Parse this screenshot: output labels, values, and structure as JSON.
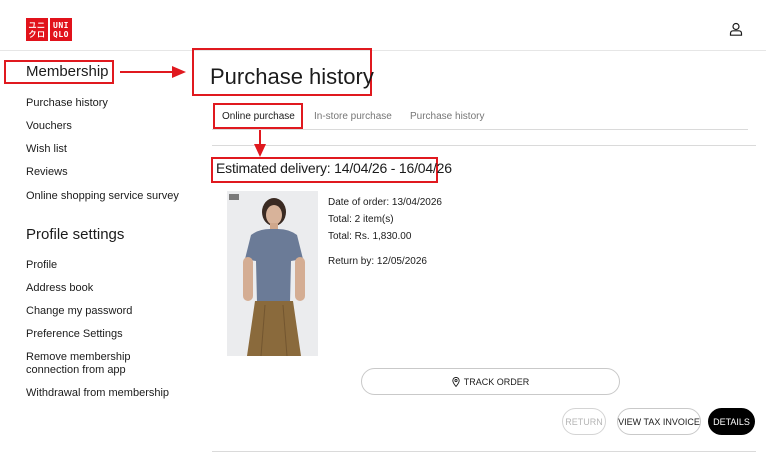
{
  "brand": {
    "logo_left": "ユニ\nクロ",
    "logo_right": "UNI\nQLO",
    "color": "#e1121b"
  },
  "header": {
    "account_icon": "user-icon"
  },
  "sidebar": {
    "membership_heading": "Membership",
    "membership_links": [
      "Purchase history",
      "Vouchers",
      "Wish list",
      "Reviews",
      "Online shopping service survey"
    ],
    "profile_heading": "Profile settings",
    "profile_links": [
      "Profile",
      "Address book",
      "Change my password",
      "Preference Settings",
      "Remove membership connection from app",
      "Withdrawal from membership"
    ]
  },
  "page": {
    "title": "Purchase history"
  },
  "tabs": [
    {
      "label": "Online purchase",
      "active": true
    },
    {
      "label": "In-store purchase",
      "active": false
    },
    {
      "label": "Purchase history",
      "active": false
    }
  ],
  "order": {
    "estimated_delivery": "Estimated delivery: 14/04/26 - 16/04/26",
    "date_of_order": "Date of order: 13/04/2026",
    "total_items": "Total: 2 item(s)",
    "total_amount": "Total: Rs. 1,830.00",
    "return_by": "Return by: 12/05/2026",
    "photo_badge": "ユニクロ"
  },
  "actions": {
    "track_order": "TRACK ORDER",
    "return": "RETURN",
    "view_tax_invoice": "VIEW TAX INVOICE",
    "details": "DETAILS"
  },
  "annotation_color": "#e0191f"
}
